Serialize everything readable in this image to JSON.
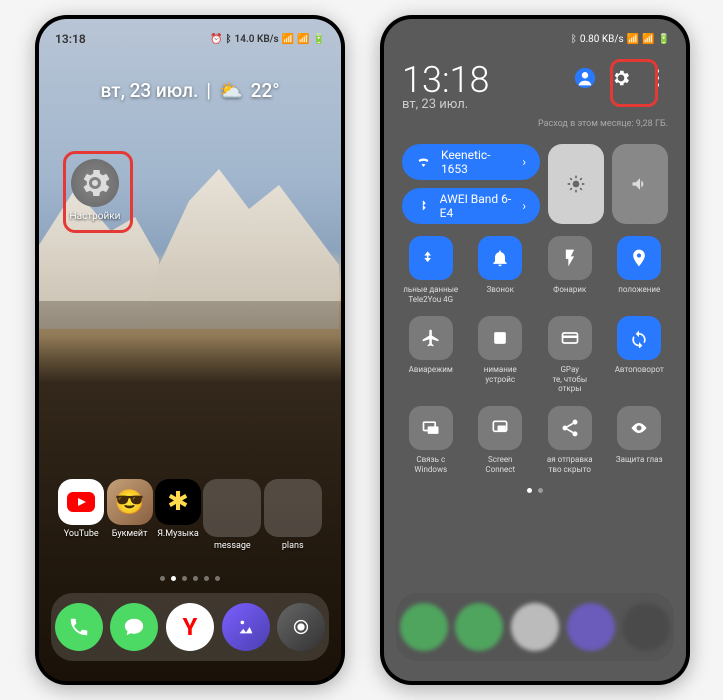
{
  "left": {
    "time": "13:18",
    "date": "вт, 23 июл.",
    "temp": "22°",
    "status_speed": "14.0 KB/s",
    "settings_label": "Настройки",
    "apps": [
      {
        "name": "YouTube"
      },
      {
        "name": "Букмейт"
      },
      {
        "name": "Я.Музыка"
      },
      {
        "name": "message"
      },
      {
        "name": "plans"
      }
    ]
  },
  "right": {
    "time": "13:18",
    "date": "вт, 23 июл.",
    "status_speed": "0.80 KB/s",
    "usage": "Расход в этом месяце: 9,28 ГБ.",
    "wifi": "Keenetic-1653",
    "bluetooth": "AWEI Band 6-E4",
    "tiles": [
      {
        "label": "льные данные\nTele2You 4G",
        "color": "blue",
        "icon": "data"
      },
      {
        "label": "Звонок",
        "color": "blue",
        "icon": "bell"
      },
      {
        "label": "Фонарик",
        "color": "gray",
        "icon": "flash"
      },
      {
        "label": "положение",
        "color": "blue",
        "icon": "location"
      },
      {
        "label": "Авиарежим",
        "color": "gray",
        "icon": "plane"
      },
      {
        "label": "нимание устройс",
        "color": "gray",
        "icon": "square"
      },
      {
        "label": "GPay\nте, чтобы откры",
        "color": "gray",
        "icon": "pay"
      },
      {
        "label": "Автоповорот",
        "color": "blue",
        "icon": "rotate"
      },
      {
        "label": "Связь с Windows",
        "color": "gray",
        "icon": "link"
      },
      {
        "label": "Screen Connect",
        "color": "gray",
        "icon": "cast"
      },
      {
        "label": "ая отправка\nтво скрыто",
        "color": "gray",
        "icon": "share"
      },
      {
        "label": "Защита глаз",
        "color": "gray",
        "icon": "eye"
      }
    ]
  }
}
